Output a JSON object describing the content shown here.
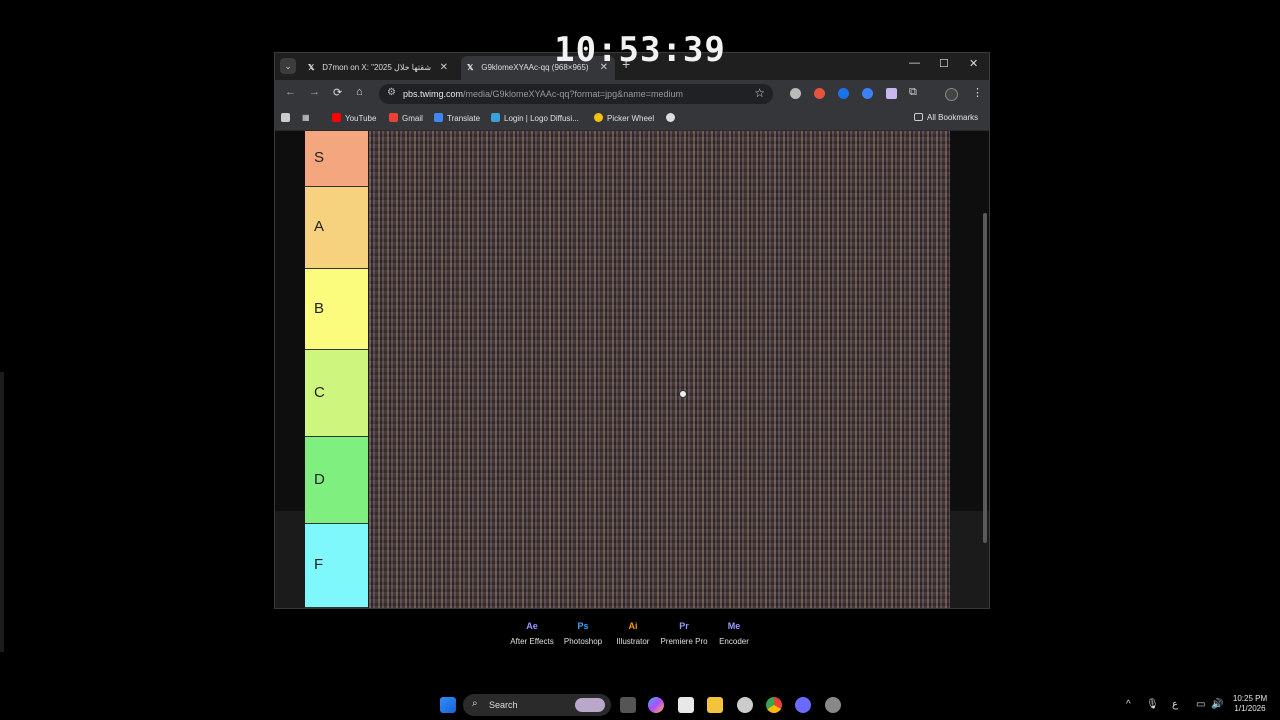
{
  "overlay": {
    "clock": "10:53:39"
  },
  "browser": {
    "tabs": [
      {
        "title": "D7mon on X: \"2025 شقتها خلال"
      },
      {
        "title": "G9klomeXYAAc-qq (968×965)"
      }
    ],
    "url": {
      "host": "pbs.twimg.com",
      "path": "/media/G9klomeXYAAc-qq?format=jpg&name=medium"
    },
    "bookmarks": [
      {
        "label": "YouTube",
        "color": "#ff0000"
      },
      {
        "label": "Gmail",
        "color": "#ea4335"
      },
      {
        "label": "Translate",
        "color": "#4285f4"
      },
      {
        "label": "Login | Logo Diffusi...",
        "color": "#3aa0d8"
      },
      {
        "label": "Picker Wheel",
        "color": "#f4c20d"
      }
    ],
    "all_bookmarks": "All Bookmarks"
  },
  "tier_list": {
    "tiers": [
      {
        "label": "S",
        "color": "#f4a77e"
      },
      {
        "label": "A",
        "color": "#f6d27f"
      },
      {
        "label": "B",
        "color": "#fbfb7d"
      },
      {
        "label": "C",
        "color": "#cef57d"
      },
      {
        "label": "D",
        "color": "#7fef7f"
      },
      {
        "label": "F",
        "color": "#7ff8fb"
      }
    ]
  },
  "desktop_apps": [
    {
      "abbr": "Ae",
      "label": "After Effects",
      "color": "#9999ff"
    },
    {
      "abbr": "Ps",
      "label": "Photoshop",
      "color": "#31a8ff"
    },
    {
      "abbr": "Ai",
      "label": "Illustrator",
      "color": "#ff9a00"
    },
    {
      "abbr": "Pr",
      "label": "Premiere Pro",
      "color": "#9999ff"
    },
    {
      "abbr": "Me",
      "label": "Encoder",
      "color": "#9999ff"
    }
  ],
  "taskbar": {
    "search_placeholder": "Search",
    "keyboard_lang": "ع",
    "time": "10:25 PM",
    "date": "1/1/2026"
  }
}
